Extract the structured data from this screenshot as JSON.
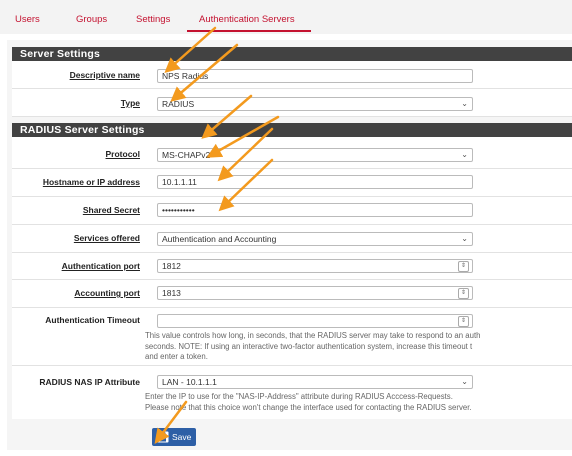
{
  "tabs": [
    {
      "label": "Users"
    },
    {
      "label": "Groups"
    },
    {
      "label": "Settings"
    },
    {
      "label": "Authentication Servers"
    }
  ],
  "server_settings": {
    "title": "Server Settings",
    "descriptive_name_label": "Descriptive name",
    "descriptive_name_value": "NPS Radius",
    "type_label": "Type",
    "type_value": "RADIUS"
  },
  "radius_settings": {
    "title": "RADIUS Server Settings",
    "protocol_label": "Protocol",
    "protocol_value": "MS-CHAPv2",
    "hostname_label": "Hostname or IP address",
    "hostname_value": "10.1.1.11",
    "secret_label": "Shared Secret",
    "secret_value": "•••••••••••",
    "services_label": "Services offered",
    "services_value": "Authentication and Accounting",
    "auth_port_label": "Authentication port",
    "auth_port_value": "1812",
    "acct_port_label": "Accounting port",
    "acct_port_value": "1813",
    "timeout_label": "Authentication Timeout",
    "timeout_value": "",
    "timeout_help_1": "This value controls how long, in seconds, that the RADIUS server may take to respond to an auth",
    "timeout_help_2": "seconds. NOTE: If using an interactive two-factor authentication system, increase this timeout t",
    "timeout_help_3": "and enter a token.",
    "nas_label": "RADIUS NAS IP Attribute",
    "nas_value": "LAN - 10.1.1.1",
    "nas_help_1": "Enter the IP to use for the \"NAS-IP-Address\" attribute during RADIUS Acccess-Requests.",
    "nas_help_2": "Please note that this choice won't change the interface used for contacting the RADIUS server."
  },
  "save_label": "Save",
  "colors": {
    "accent": "#c41230",
    "header": "#424242",
    "button": "#2d5fa6",
    "arrow": "#f39a1e"
  }
}
